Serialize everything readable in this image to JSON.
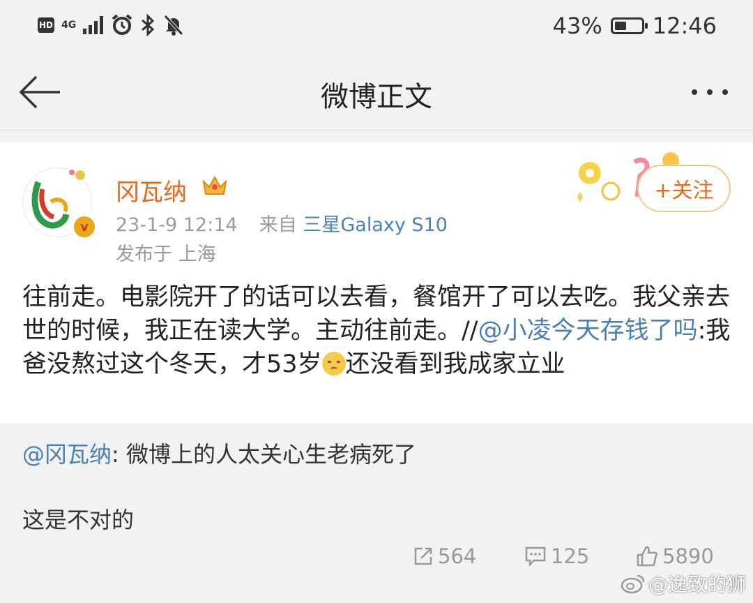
{
  "status_bar": {
    "hd": "HD",
    "network": "4G",
    "battery_percent": "43%",
    "battery_level": 0.43,
    "time": "12:46",
    "icons": [
      "hd-icon",
      "signal-icon",
      "alarm-icon",
      "bluetooth-icon",
      "mute-bell-icon",
      "battery-icon"
    ]
  },
  "title_bar": {
    "title": "微博正文"
  },
  "post": {
    "username": "冈瓦纳",
    "timestamp": "23-1-9 12:14",
    "source_prefix": "来自",
    "source": "三星Galaxy S10",
    "location": "发布于 上海",
    "follow_label": "+关注",
    "text_part1": "往前走。电影院开了的话可以去看，餐馆开了可以去吃。我父亲去世的时候，我正在读大学。主动往前走。//",
    "mention": "@小凌今天存钱了吗",
    "text_part2": ":我爸没熬过这个冬天，才53岁",
    "text_part3": "还没看到我成家立业"
  },
  "retweet": {
    "mention": "@冈瓦纳",
    "text": ": 微博上的人太关心生老病死了",
    "line2": "这是不对的"
  },
  "actions": {
    "repost_count": "564",
    "comment_count": "125",
    "like_count": "5890"
  },
  "watermark": "@逸致的狮",
  "colors": {
    "username": "#e8681a",
    "link": "#4a7fb5",
    "muted": "#999999"
  }
}
